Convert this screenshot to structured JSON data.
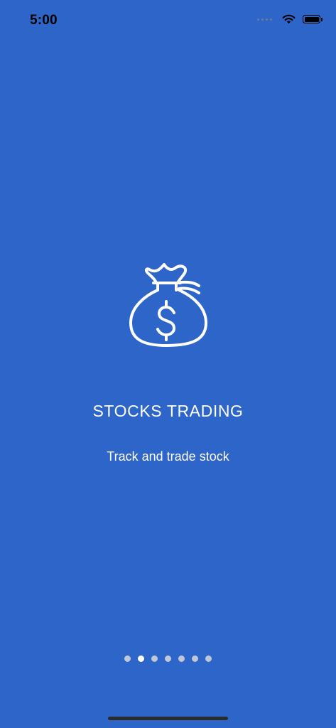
{
  "status_bar": {
    "time": "5:00"
  },
  "onboarding": {
    "icon": "money-bag-icon",
    "title": "STOCKS TRADING",
    "subtitle": "Track and trade stock",
    "page_count": 7,
    "active_page": 2
  },
  "colors": {
    "background": "#2e65c9",
    "text": "#ffffff",
    "dot_inactive": "#c0c8d8",
    "dot_active": "#ffffff"
  }
}
